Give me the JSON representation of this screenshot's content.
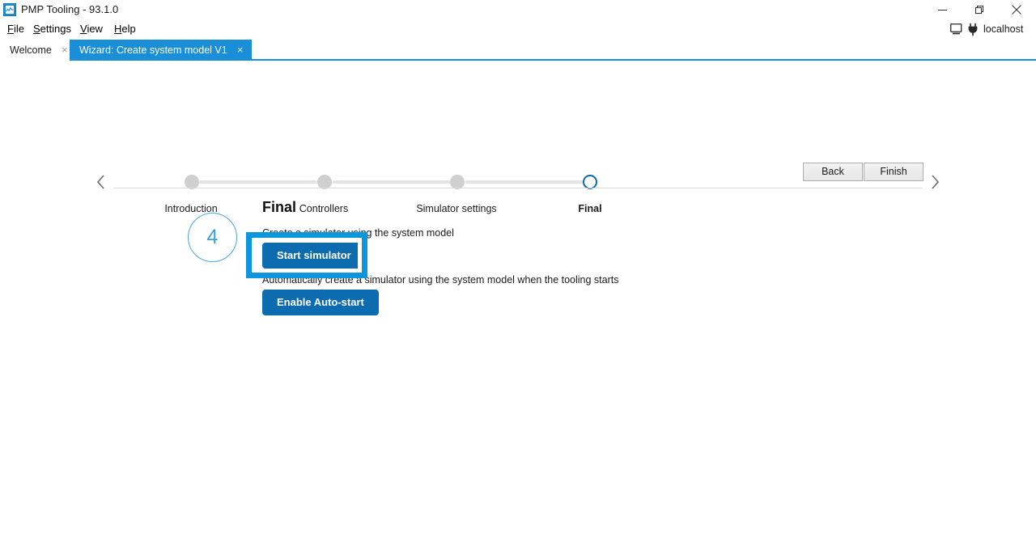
{
  "window": {
    "title": "PMP Tooling - 93.1.0",
    "app_icon": "chart-app-icon",
    "minimize_icon": "minimize-icon",
    "maximize_icon": "restore-icon",
    "close_icon": "close-icon"
  },
  "menubar": {
    "items": [
      {
        "mnemonic": "F",
        "rest": "ile"
      },
      {
        "mnemonic": "S",
        "rest": "ettings"
      },
      {
        "mnemonic": "V",
        "rest": "iew"
      },
      {
        "mnemonic": "H",
        "rest": "elp"
      }
    ]
  },
  "status": {
    "monitor_icon": "monitor-icon",
    "plug_icon": "plug-icon",
    "host": "localhost"
  },
  "tabs": [
    {
      "label": "Welcome",
      "close": "×",
      "active": false
    },
    {
      "label": "Wizard: Create system model V1",
      "close": "×",
      "active": true
    }
  ],
  "stepper": {
    "prev_icon": "chevron-left-icon",
    "next_icon": "chevron-right-icon",
    "steps": [
      {
        "label": "Introduction",
        "state": "done"
      },
      {
        "label": "Controllers",
        "state": "done"
      },
      {
        "label": "Simulator settings",
        "state": "done"
      },
      {
        "label": "Final",
        "state": "current"
      }
    ]
  },
  "actions": {
    "back_label": "Back",
    "finish_label": "Finish"
  },
  "panel": {
    "number": "4",
    "title": "Final",
    "description_1": "Create a simulator using the system model",
    "start_simulator_label": "Start simulator",
    "description_2": "Automatically create a simulator using the system model when the tooling starts",
    "enable_autostart_label": "Enable Auto-start"
  },
  "colors": {
    "accent_blue": "#1a8fd8",
    "button_blue": "#0d6cb0",
    "highlight_blue": "#0d96dc",
    "step_current": "#0b6ab0",
    "step_circle": "#45a7de",
    "track_gray": "#e3e3e3",
    "node_gray": "#cfcfcf"
  }
}
